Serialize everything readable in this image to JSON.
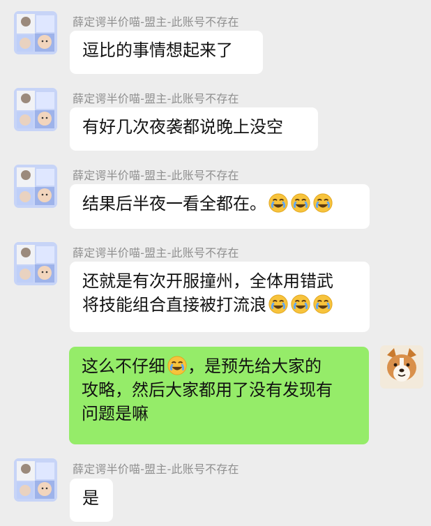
{
  "messages": [
    {
      "nickname": "薛定谔半价喵-盟主-此账号不存在",
      "lines": [
        "逗比的事情想起来了"
      ]
    },
    {
      "nickname": "薛定谔半价喵-盟主-此账号不存在",
      "lines": [
        "有好几次夜袭都说晚上没空"
      ]
    },
    {
      "nickname": "薛定谔半价喵-盟主-此账号不存在",
      "lines": [
        "结果后半夜一看全都在。"
      ],
      "emoji_names": [
        "cry-laugh-emoji",
        "cry-laugh-emoji",
        "cry-laugh-emoji"
      ]
    },
    {
      "nickname": "薛定谔半价喵-盟主-此账号不存在",
      "lines": [
        "还就是有次开服撞州，全体用错武",
        "将技能组合直接被打流浪"
      ],
      "emoji_names": [
        "cry-laugh-emoji",
        "cry-laugh-emoji",
        "cry-laugh-emoji"
      ]
    },
    {
      "self": true,
      "lines": [
        "这么不仔细",
        "，是预先给大家的",
        "攻略，然后大家都用了没有发现有",
        "问题是嘛"
      ],
      "emoji_names": [
        "cry-laugh-emoji"
      ]
    },
    {
      "nickname": "薛定谔半价喵-盟主-此账号不存在",
      "lines": [
        "是"
      ]
    }
  ],
  "colors": {
    "background": "#ededed",
    "bubble_other": "#ffffff",
    "bubble_self": "#95ec69",
    "nickname": "#8f8f8f"
  },
  "icons": {
    "other_avatar": "child-photo-avatar-icon",
    "self_avatar": "corgi-dog-avatar-icon"
  }
}
